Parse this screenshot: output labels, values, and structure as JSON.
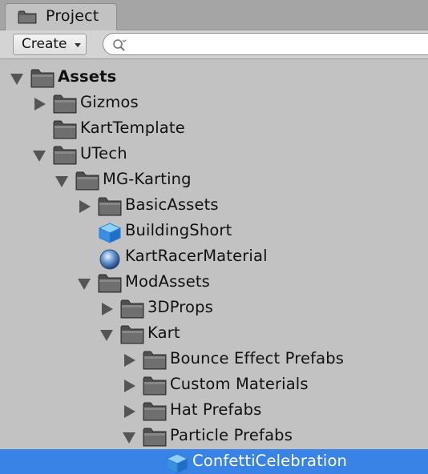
{
  "tab": {
    "label": "Project",
    "icon": "folder-icon"
  },
  "toolbar": {
    "create_label": "Create",
    "search_placeholder": ""
  },
  "tree": [
    {
      "label": "Assets",
      "depth": 0,
      "toggle": "open",
      "icon": "folder",
      "bold": true,
      "selected": false
    },
    {
      "label": "Gizmos",
      "depth": 1,
      "toggle": "closed",
      "icon": "folder",
      "bold": false,
      "selected": false
    },
    {
      "label": "KartTemplate",
      "depth": 1,
      "toggle": "none",
      "icon": "folder",
      "bold": false,
      "selected": false
    },
    {
      "label": "UTech",
      "depth": 1,
      "toggle": "open",
      "icon": "folder",
      "bold": false,
      "selected": false
    },
    {
      "label": "MG-Karting",
      "depth": 2,
      "toggle": "open",
      "icon": "folder",
      "bold": false,
      "selected": false
    },
    {
      "label": "BasicAssets",
      "depth": 3,
      "toggle": "closed",
      "icon": "folder",
      "bold": false,
      "selected": false
    },
    {
      "label": "BuildingShort",
      "depth": 3,
      "toggle": "none",
      "icon": "prefab-cube",
      "bold": false,
      "selected": false
    },
    {
      "label": "KartRacerMaterial",
      "depth": 3,
      "toggle": "none",
      "icon": "material-sphere",
      "bold": false,
      "selected": false
    },
    {
      "label": "ModAssets",
      "depth": 3,
      "toggle": "open",
      "icon": "folder",
      "bold": false,
      "selected": false
    },
    {
      "label": "3DProps",
      "depth": 4,
      "toggle": "closed",
      "icon": "folder",
      "bold": false,
      "selected": false
    },
    {
      "label": "Kart",
      "depth": 4,
      "toggle": "open",
      "icon": "folder",
      "bold": false,
      "selected": false
    },
    {
      "label": "Bounce Effect Prefabs",
      "depth": 5,
      "toggle": "closed",
      "icon": "folder",
      "bold": false,
      "selected": false
    },
    {
      "label": "Custom Materials",
      "depth": 5,
      "toggle": "closed",
      "icon": "folder",
      "bold": false,
      "selected": false
    },
    {
      "label": "Hat Prefabs",
      "depth": 5,
      "toggle": "closed",
      "icon": "folder",
      "bold": false,
      "selected": false
    },
    {
      "label": "Particle Prefabs",
      "depth": 5,
      "toggle": "open",
      "icon": "folder",
      "bold": false,
      "selected": false
    },
    {
      "label": "ConfettiCelebration",
      "depth": 6,
      "toggle": "none",
      "icon": "prefab-cube",
      "bold": false,
      "selected": true
    }
  ]
}
